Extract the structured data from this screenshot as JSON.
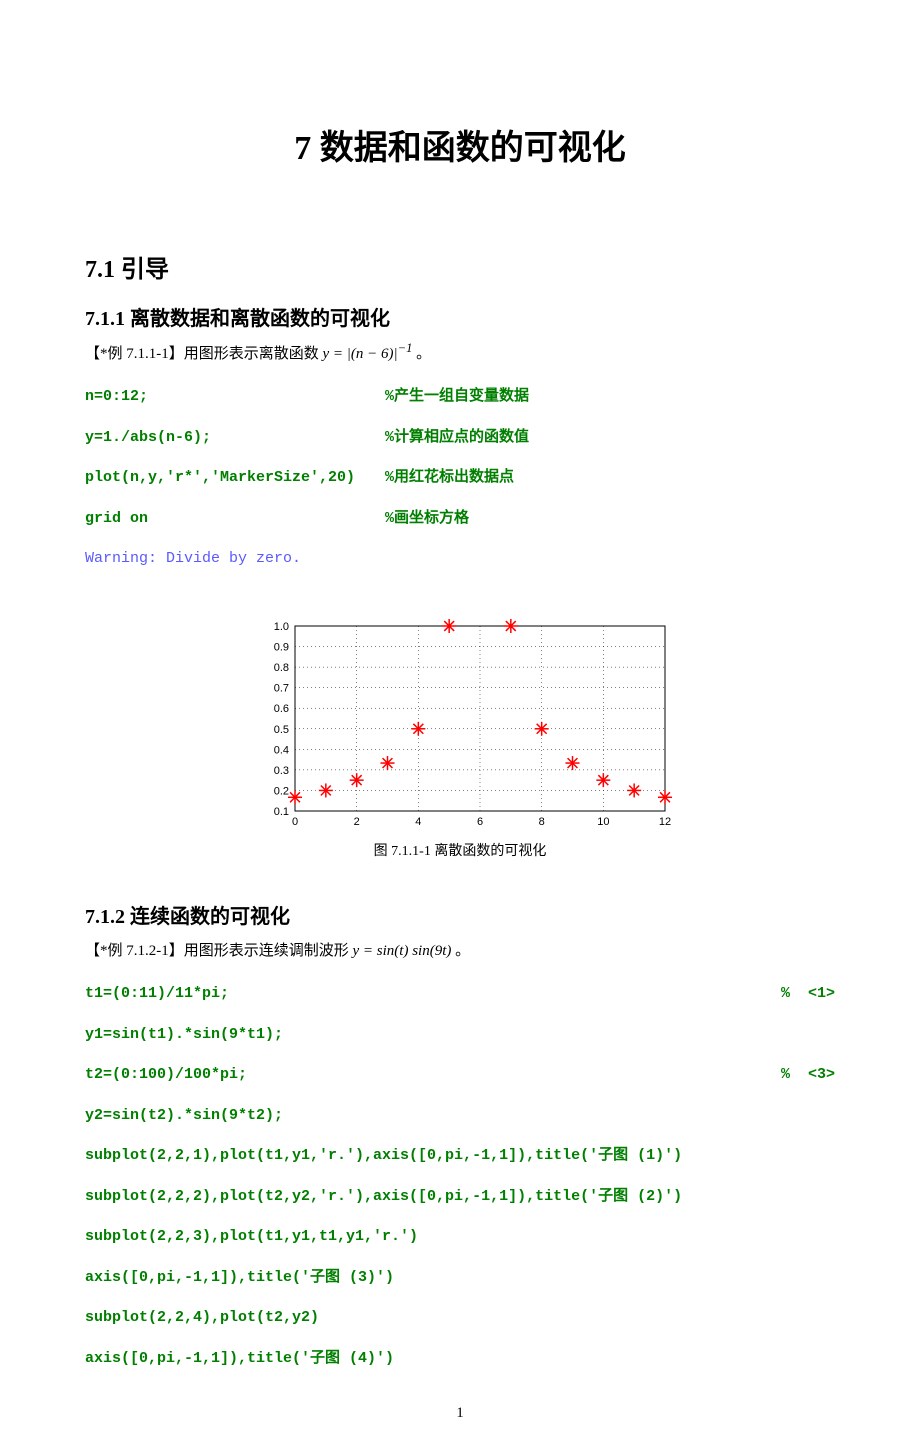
{
  "chapter_title": "7 数据和函数的可视化",
  "section_7_1": "7.1  引导",
  "sub_7_1_1": "7.1.1  离散数据和离散函数的可视化",
  "ex_711_prefix": "【*例 7.1.1-1】用图形表示离散函数 ",
  "ex_711_formula_html": "y = |(n − 6)|<sup>−1</sup>",
  "ex_711_suffix": " 。",
  "code1": {
    "l1": "n=0:12;",
    "c1": "%产生一组自变量数据",
    "l2": "y=1./abs(n-6);",
    "c2": "%计算相应点的函数值",
    "l3": "plot(n,y,'r*','MarkerSize',20)",
    "c3": "%用红花标出数据点",
    "l4": "grid on",
    "c4": "%画坐标方格",
    "warn": "Warning: Divide by zero."
  },
  "fig_711_caption": "图 7.1.1-1  离散函数的可视化",
  "sub_7_1_2": "7.1.2  连续函数的可视化",
  "ex_712_prefix": "【*例 7.1.2-1】用图形表示连续调制波形 ",
  "ex_712_formula_html": "y = sin(<i>t</i>) sin(9<i>t</i>)",
  "ex_712_suffix": " 。",
  "code2": {
    "l1": "t1=(0:11)/11*pi;",
    "r1": "%  <1>",
    "l2": "y1=sin(t1).*sin(9*t1);",
    "l3": "t2=(0:100)/100*pi;",
    "r3": "%  <3>",
    "l4": "y2=sin(t2).*sin(9*t2);",
    "l5": "subplot(2,2,1),plot(t1,y1,'r.'),axis([0,pi,-1,1]),title('子图 (1)')",
    "l6": "subplot(2,2,2),plot(t2,y2,'r.'),axis([0,pi,-1,1]),title('子图 (2)')",
    "l7": "subplot(2,2,3),plot(t1,y1,t1,y1,'r.')",
    "l8": "axis([0,pi,-1,1]),title('子图 (3)')",
    "l9": "subplot(2,2,4),plot(t2,y2)",
    "l10": "axis([0,pi,-1,1]),title('子图 (4)')"
  },
  "page_number": "1",
  "chart_data": {
    "type": "scatter",
    "title": "",
    "xlabel": "",
    "ylabel": "",
    "x": [
      0,
      1,
      2,
      3,
      4,
      5,
      7,
      8,
      9,
      10,
      11,
      12
    ],
    "y": [
      0.1667,
      0.2,
      0.25,
      0.3333,
      0.5,
      1.0,
      1.0,
      0.5,
      0.3333,
      0.25,
      0.2,
      0.1667
    ],
    "xlim": [
      0,
      12
    ],
    "ylim": [
      0.1,
      1.0
    ],
    "xticks": [
      0,
      2,
      4,
      6,
      8,
      10,
      12
    ],
    "yticks": [
      0.1,
      0.2,
      0.3,
      0.4,
      0.5,
      0.6,
      0.7,
      0.8,
      0.9,
      1.0
    ],
    "marker": "r*",
    "grid": true,
    "note": "n=6 produces Inf (divide by zero) and is not plotted"
  }
}
